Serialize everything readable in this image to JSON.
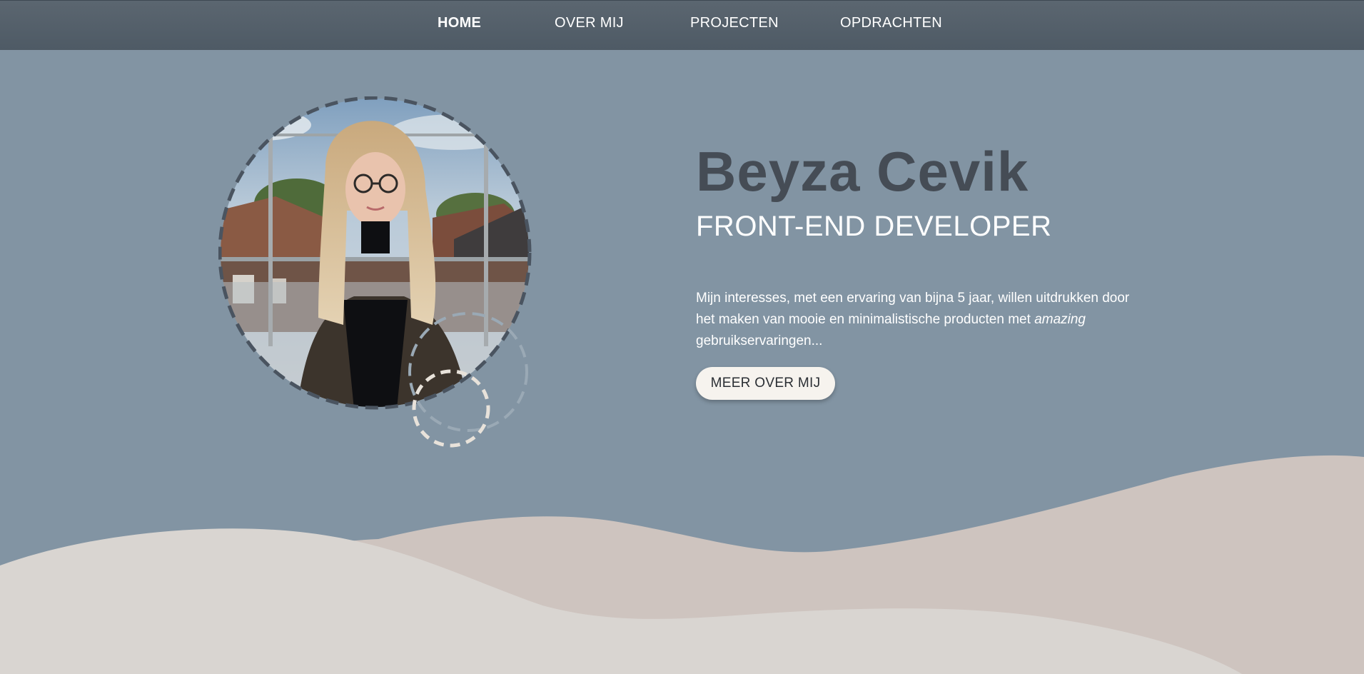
{
  "nav": {
    "items": [
      {
        "label": "HOME",
        "active": true
      },
      {
        "label": "OVER MIJ",
        "active": false
      },
      {
        "label": "PROJECTEN",
        "active": false
      },
      {
        "label": "OPDRACHTEN",
        "active": false
      }
    ]
  },
  "hero": {
    "name": "Beyza Cevik",
    "role": "FRONT-END DEVELOPER",
    "intro_part1": "Mijn interesses, met een ervaring van bijna 5 jaar, willen uitdrukken door het maken van mooie en minimalistische producten met ",
    "intro_emphasis": "amazing",
    "intro_part2": " gebruikservaringen...",
    "cta_label": "MEER OVER MIJ"
  },
  "colors": {
    "nav_bg": "#4e5a65",
    "hero_bg": "#8294a3",
    "name_color": "#454c55",
    "wave_back": "#cec4bf",
    "wave_front": "#d9d5d1",
    "button_bg": "#f6f3ee"
  },
  "icons": {
    "decoration": "dashed-circle-icon"
  }
}
